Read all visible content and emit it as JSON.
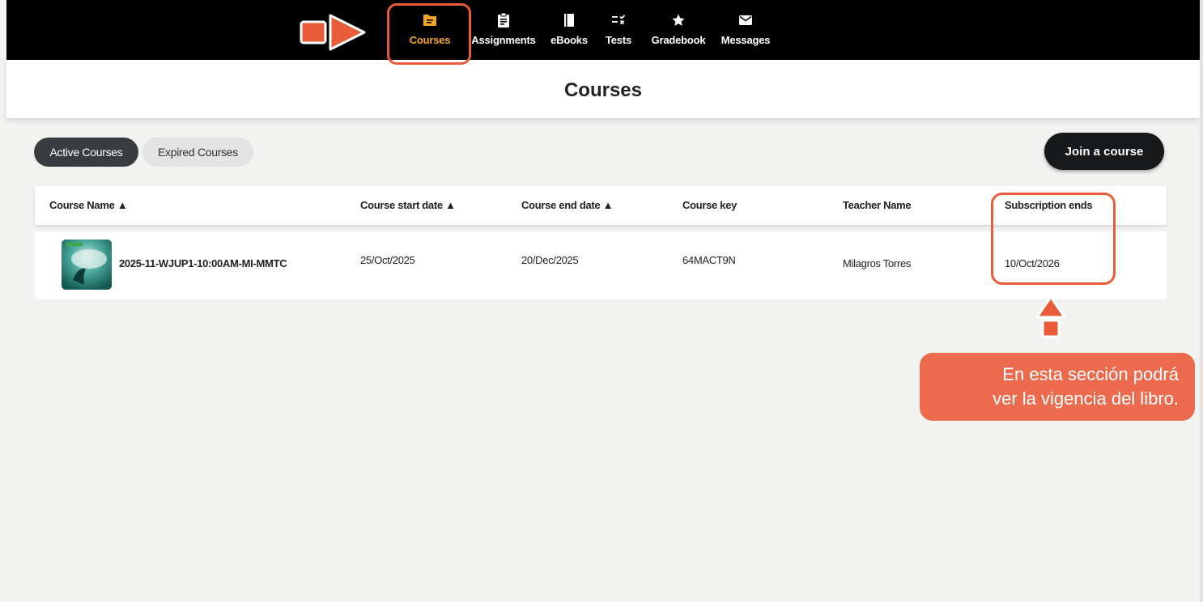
{
  "nav": {
    "items": [
      {
        "label": "Courses",
        "icon": "folder-icon",
        "active": true
      },
      {
        "label": "Assignments",
        "icon": "clipboard-icon",
        "active": false
      },
      {
        "label": "eBooks",
        "icon": "book-icon",
        "active": false
      },
      {
        "label": "Tests",
        "icon": "checklist-icon",
        "active": false
      },
      {
        "label": "Gradebook",
        "icon": "star-icon",
        "active": false
      },
      {
        "label": "Messages",
        "icon": "envelope-icon",
        "active": false
      }
    ]
  },
  "header": {
    "title": "Courses"
  },
  "filters": {
    "active_label": "Active Courses",
    "expired_label": "Expired Courses"
  },
  "join_button": {
    "label": "Join a course"
  },
  "table": {
    "columns": [
      "Course Name ▲",
      "Course start date ▲",
      "Course end date ▲",
      "Course key",
      "Teacher Name",
      "Subscription ends"
    ],
    "rows": [
      {
        "course_name": "2025-11-WJUP1-10:00AM-MI-MMTC",
        "start_date": "25/Oct/2025",
        "end_date": "20/Dec/2025",
        "course_key": "64MACT9N",
        "teacher": "Milagros Torres",
        "subscription_ends": "10/Oct/2026"
      }
    ]
  },
  "callout": {
    "line1": "En esta sección podrá",
    "line2": "ver la vigencia del libro."
  },
  "colors": {
    "accent": "#f5a623",
    "annotation": "#ea5b3a",
    "callout_bg": "#ec6b4e",
    "nav_bg": "#000000",
    "page_bg": "#f2f2f1"
  }
}
